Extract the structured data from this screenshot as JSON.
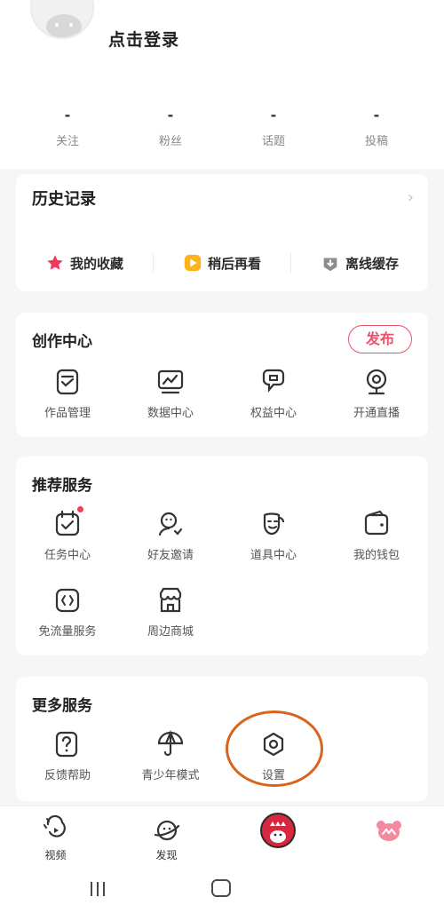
{
  "profile": {
    "login_prompt": "点击登录"
  },
  "stats": [
    {
      "value": "-",
      "label": "关注"
    },
    {
      "value": "-",
      "label": "粉丝"
    },
    {
      "value": "-",
      "label": "话题"
    },
    {
      "value": "-",
      "label": "投稿"
    }
  ],
  "history": {
    "title": "历史记录",
    "arrow": "›",
    "quick": [
      {
        "label": "我的收藏",
        "icon": "star-icon"
      },
      {
        "label": "稍后再看",
        "icon": "play-later-icon"
      },
      {
        "label": "离线缓存",
        "icon": "download-icon"
      }
    ]
  },
  "create_center": {
    "title": "创作中心",
    "publish": "发布",
    "items": [
      {
        "label": "作品管理",
        "icon": "works-icon"
      },
      {
        "label": "数据中心",
        "icon": "chart-icon"
      },
      {
        "label": "权益中心",
        "icon": "badge-icon"
      },
      {
        "label": "开通直播",
        "icon": "camera-icon"
      }
    ]
  },
  "recommended": {
    "title": "推荐服务",
    "items": [
      {
        "label": "任务中心",
        "icon": "calendar-task-icon"
      },
      {
        "label": "好友邀请",
        "icon": "invite-icon"
      },
      {
        "label": "道具中心",
        "icon": "mask-icon"
      },
      {
        "label": "我的钱包",
        "icon": "wallet-icon"
      },
      {
        "label": "免流量服务",
        "icon": "sim-card-icon"
      },
      {
        "label": "周边商城",
        "icon": "shop-icon"
      }
    ]
  },
  "more": {
    "title": "更多服务",
    "items": [
      {
        "label": "反馈帮助",
        "icon": "help-icon"
      },
      {
        "label": "青少年模式",
        "icon": "umbrella-icon"
      },
      {
        "label": "设置",
        "icon": "settings-icon"
      }
    ]
  },
  "bottom_nav": [
    {
      "label": "视频",
      "icon": "video-icon"
    },
    {
      "label": "发现",
      "icon": "planet-icon"
    },
    {
      "label": "",
      "icon": "create-avatar-icon"
    },
    {
      "label": "",
      "icon": "profile-mascot-icon"
    }
  ],
  "colors": {
    "accent": "#e8536b",
    "highlight": "#d9641b"
  }
}
